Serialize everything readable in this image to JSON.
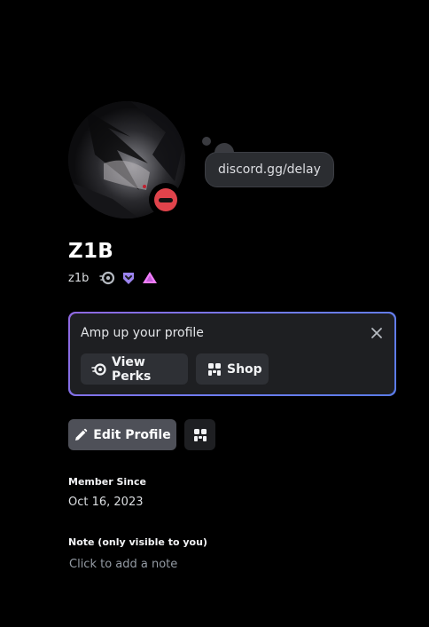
{
  "profile": {
    "display_name": "Z1B",
    "username": "z1b",
    "custom_status": "discord.gg/delay",
    "status": "do-not-disturb",
    "badges": [
      "nitro-badge-icon",
      "hypesquad-badge-icon",
      "boost-badge-icon"
    ]
  },
  "promo": {
    "title": "Amp up your profile",
    "perks_label": "View Perks",
    "shop_label": "Shop"
  },
  "actions": {
    "edit_profile_label": "Edit Profile"
  },
  "member_since": {
    "label": "Member Since",
    "date": "Oct 16, 2023"
  },
  "note": {
    "label": "Note (only visible to you)",
    "placeholder": "Click to add a note"
  },
  "colors": {
    "background": "#000000",
    "card": "#1e1f22",
    "button": "#2e3035",
    "edit_button": "#4e5058",
    "dnd_status": "#e0434b",
    "gradient_start": "#8f68e0",
    "gradient_end": "#5a7be6"
  }
}
